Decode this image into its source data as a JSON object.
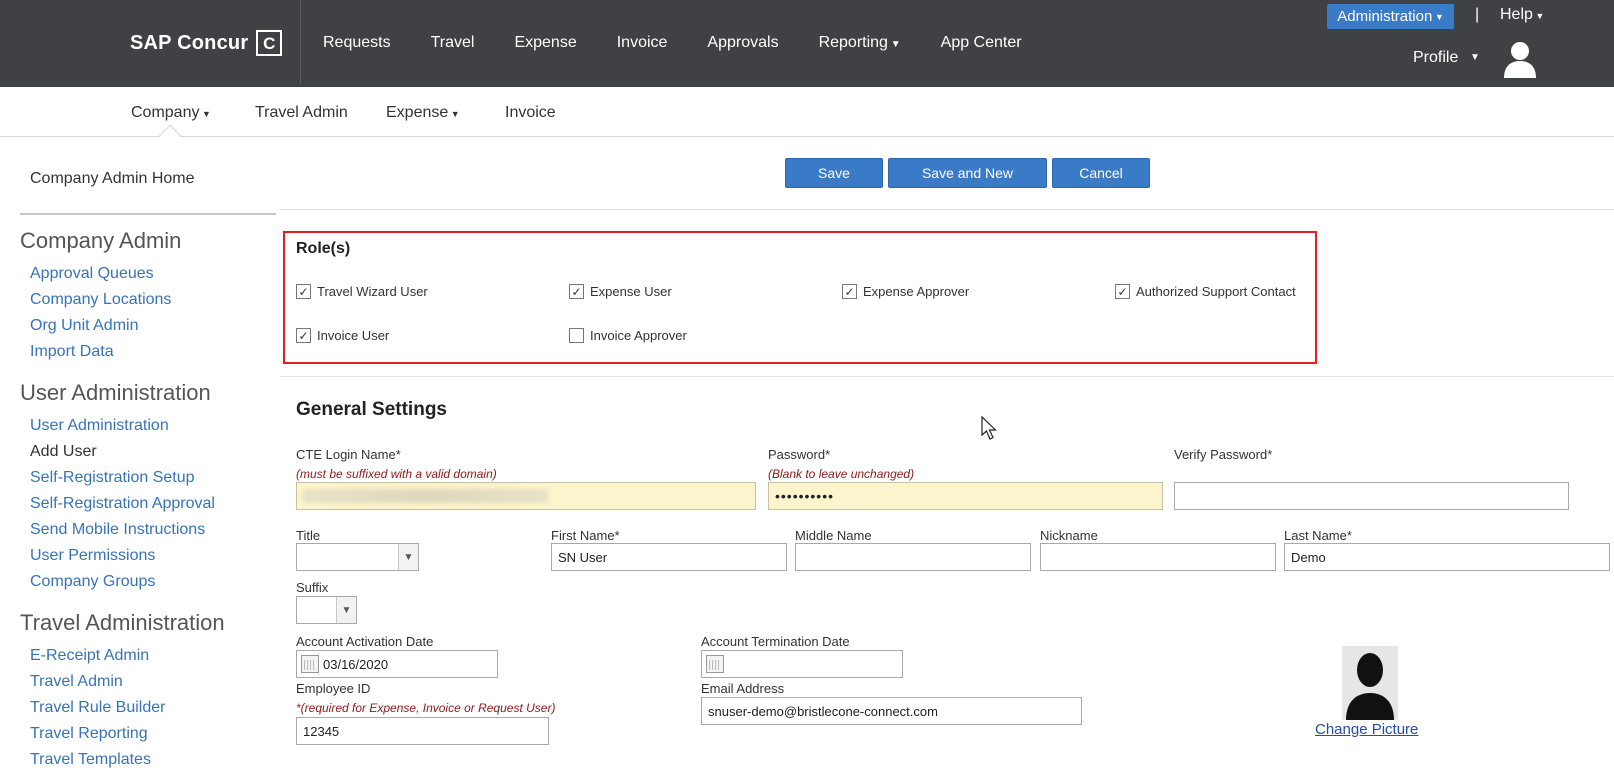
{
  "brand": {
    "name": "SAP Concur",
    "mark": "C"
  },
  "topnav": [
    "Requests",
    "Travel",
    "Expense",
    "Invoice",
    "Approvals",
    "Reporting",
    "App Center"
  ],
  "header": {
    "admin": "Administration",
    "pipe": "|",
    "help": "Help",
    "profile": "Profile"
  },
  "subnav": [
    "Company",
    "Travel Admin",
    "Expense",
    "Invoice"
  ],
  "sidebar": {
    "home": "Company Admin Home",
    "sections": [
      {
        "title": "Company Admin",
        "links": [
          "Approval Queues",
          "Company Locations",
          "Org Unit Admin",
          "Import Data"
        ]
      },
      {
        "title": "User Administration",
        "links": [
          "User Administration",
          "Add User",
          "Self-Registration Setup",
          "Self-Registration Approval",
          "Send Mobile Instructions",
          "User Permissions",
          "Company Groups"
        ]
      },
      {
        "title": "Travel Administration",
        "links": [
          "E-Receipt Admin",
          "Travel Admin",
          "Travel Rule Builder",
          "Travel Reporting",
          "Travel Templates"
        ]
      }
    ]
  },
  "actions": {
    "save": "Save",
    "save_new": "Save and New",
    "cancel": "Cancel"
  },
  "roles": {
    "title": "Role(s)",
    "items": [
      {
        "label": "Travel Wizard User",
        "checked": true
      },
      {
        "label": "Expense User",
        "checked": true
      },
      {
        "label": "Expense Approver",
        "checked": true
      },
      {
        "label": "Authorized Support Contact",
        "checked": true
      },
      {
        "label": "Invoice User",
        "checked": true
      },
      {
        "label": "Invoice Approver",
        "checked": false
      }
    ]
  },
  "general": {
    "title": "General Settings",
    "login_label": "CTE Login Name*",
    "login_note": "(must be suffixed with a valid domain)",
    "password_label": "Password*",
    "password_note": "(Blank to leave unchanged)",
    "password_value": "••••••••••",
    "verify_label": "Verify Password*",
    "title_label": "Title",
    "first_label": "First Name*",
    "first_value": "SN User",
    "middle_label": "Middle Name",
    "nickname_label": "Nickname",
    "last_label": "Last Name*",
    "last_value": "Demo",
    "suffix_label": "Suffix",
    "activation_label": "Account Activation Date",
    "activation_value": "03/16/2020",
    "termination_label": "Account Termination Date",
    "empid_label": "Employee ID",
    "empid_note_star": "*",
    "empid_note": "(required for Expense, Invoice or Request User)",
    "empid_value": "12345",
    "email_label": "Email Address",
    "email_value": "snuser-demo@bristlecone-connect.com",
    "change_picture": "Change Picture"
  }
}
